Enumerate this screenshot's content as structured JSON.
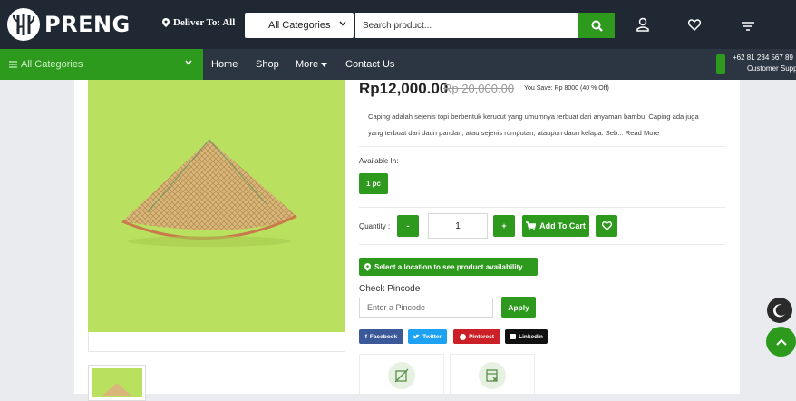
{
  "header": {
    "brand": "PRENG",
    "deliver_to": "Deliver To: All",
    "category_select": "All Categories",
    "search_placeholder": "Search product..."
  },
  "nav": {
    "all_categories": "All Categories",
    "links": [
      "Home",
      "Shop",
      "More",
      "Contact Us"
    ],
    "phone": "+62 81 234 567 89",
    "support": "Customer Support"
  },
  "product": {
    "price": "Rp12,000.00",
    "old_price": "Rp 20,000.00",
    "you_save": "You Save: Rp 8000 (40 % Off)",
    "description": "Caping adalah sejenis topi berbentuk kerucut yang umumnya terbuat dari anyaman bambu. Caping ada juga yang terbuat dari daun pandan, atau sejenis rumputan, ataupun daun kelapa. Seb... Read More",
    "available_label": "Available In:",
    "pack_option": "1 pc",
    "quantity_label": "Quantity :",
    "quantity_value": "1",
    "minus": "-",
    "plus": "+",
    "add_to_cart": "Add To Cart",
    "location_button": "Select a location to see product availability",
    "check_pincode_label": "Check Pincode",
    "pincode_placeholder": "Enter a Pincode",
    "apply": "Apply"
  },
  "share": {
    "facebook": "Facebook",
    "twitter": "Twitter",
    "pinterest": "Pinterest",
    "linkedin": "Linkedin"
  },
  "colors": {
    "accent": "#2e9a1d",
    "header_bg": "#1f2833",
    "nav_bg": "#2c3542",
    "image_bg": "#b9e05f",
    "facebook": "#3b5998",
    "twitter": "#1da1f2",
    "pinterest": "#cb2027",
    "linkedin": "#111111"
  },
  "icons": [
    "map-pin-icon",
    "chevron-down-icon",
    "search-icon",
    "user-icon",
    "heart-icon",
    "cart-icon",
    "menu-icon",
    "moon-icon",
    "chevron-up-icon"
  ]
}
